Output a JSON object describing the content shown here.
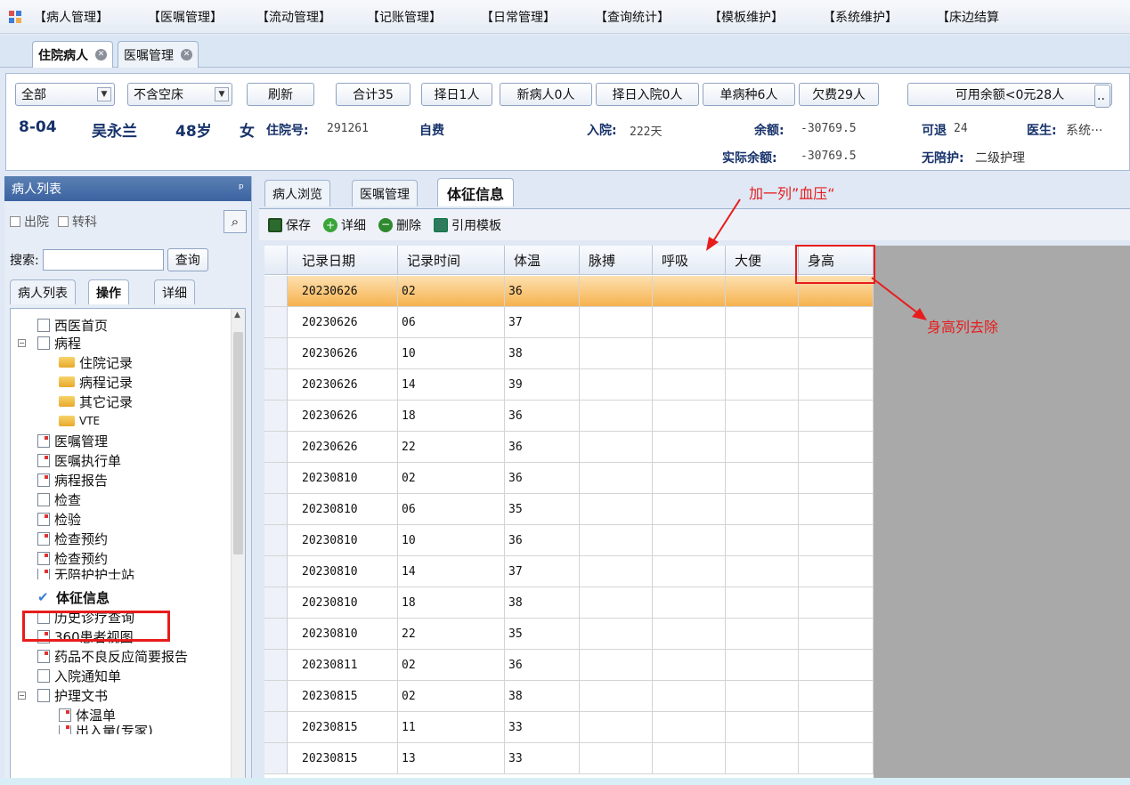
{
  "menubar": {
    "items": [
      "【病人管理】",
      "【医嘱管理】",
      "【流动管理】",
      "【记账管理】",
      "【日常管理】",
      "【查询统计】",
      "【模板维护】",
      "【系统维护】",
      "【床边结算"
    ]
  },
  "doc_tabs": [
    {
      "label": "住院病人"
    },
    {
      "label": "医嘱管理"
    }
  ],
  "filters": {
    "scope": "全部",
    "bed": "不含空床"
  },
  "buttons": {
    "refresh": "刷新",
    "total": "合计35",
    "selected_day": "择日1人",
    "new_patients": "新病人0人",
    "selected_admit": "择日入院0人",
    "single_disease": "单病种6人",
    "arrears": "欠费29人",
    "balance_lt0": "可用余额<0元28人",
    "more": ".."
  },
  "patient": {
    "bed": "8-04",
    "name": "吴永兰",
    "age": "48岁",
    "sex": "女",
    "inpatient_no_label": "住院号:",
    "inpatient_no": "291261",
    "payment": "自费",
    "admit_label": "入院:",
    "admit_days": "222天",
    "balance_label": "余额:",
    "balance": "-30769.5",
    "actual_balance_label": "实际余额:",
    "actual_balance": "-30769.5",
    "refundable_label": "可退",
    "refundable": "24",
    "doctor_label": "医生:",
    "doctor": "系统···",
    "no_escort_label": "无陪护:",
    "nursing": "二级护理"
  },
  "left": {
    "title": "病人列表",
    "pin": "ᵖ",
    "discharged": "出院",
    "transfer": "转科",
    "search_label": "搜索:",
    "query_btn": "查询",
    "tabs": [
      "病人列表",
      "操作",
      "详细"
    ],
    "tree": [
      "西医首页",
      "病程",
      "住院记录",
      "病程记录",
      "其它记录",
      "VTE",
      "医嘱管理",
      "医嘱执行单",
      "病程报告",
      "检查",
      "检验",
      "检查预约",
      "检查预约",
      "无陪护护士站",
      "体征信息",
      "历史诊疗查询",
      "360患者视图",
      "药品不良反应简要报告",
      "入院通知单",
      "护理文书",
      "体温单",
      "出入量(专家)"
    ]
  },
  "right": {
    "tabs": [
      "病人浏览",
      "医嘱管理",
      "体征信息"
    ],
    "toolbar": {
      "save": "保存",
      "detail": "详细",
      "delete": "删除",
      "template": "引用模板"
    },
    "columns": [
      "记录日期",
      "记录时间",
      "体温",
      "脉搏",
      "呼吸",
      "大便",
      "身高"
    ],
    "rows": [
      [
        "20230626",
        "02",
        "36"
      ],
      [
        "20230626",
        "06",
        "37"
      ],
      [
        "20230626",
        "10",
        "38"
      ],
      [
        "20230626",
        "14",
        "39"
      ],
      [
        "20230626",
        "18",
        "36"
      ],
      [
        "20230626",
        "22",
        "36"
      ],
      [
        "20230810",
        "02",
        "36"
      ],
      [
        "20230810",
        "06",
        "35"
      ],
      [
        "20230810",
        "10",
        "36"
      ],
      [
        "20230810",
        "14",
        "37"
      ],
      [
        "20230810",
        "18",
        "38"
      ],
      [
        "20230810",
        "22",
        "35"
      ],
      [
        "20230811",
        "02",
        "36"
      ],
      [
        "20230815",
        "02",
        "38"
      ],
      [
        "20230815",
        "11",
        "33"
      ],
      [
        "20230815",
        "13",
        "33"
      ]
    ]
  },
  "annotations": {
    "add_column": "加一列”血压“",
    "remove_height": "身高列去除"
  }
}
